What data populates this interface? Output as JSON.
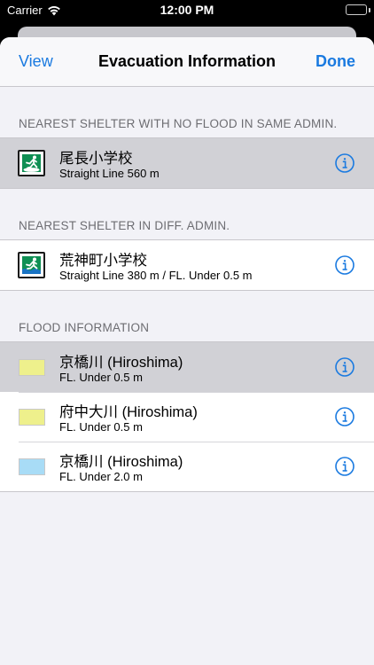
{
  "status_bar": {
    "carrier": "Carrier",
    "time": "12:00 PM"
  },
  "nav": {
    "left": "View",
    "title": "Evacuation Information",
    "right": "Done"
  },
  "sections": [
    {
      "header": "NEAREST SHELTER WITH NO FLOOD IN SAME ADMIN.",
      "rows": [
        {
          "title": "尾長小学校",
          "subtitle": "Straight Line 560 m",
          "icon": "evacuation-shelter-icon",
          "selected": true
        }
      ]
    },
    {
      "header": "NEAREST SHELTER IN DIFF. ADMIN.",
      "rows": [
        {
          "title": "荒神町小学校",
          "subtitle": "Straight Line 380 m / FL. Under 0.5 m",
          "icon": "evacuation-shelter-flood-icon",
          "selected": false
        }
      ]
    },
    {
      "header": "FLOOD INFORMATION",
      "rows": [
        {
          "title": "京橋川 (Hiroshima)",
          "subtitle": "FL. Under 0.5 m",
          "swatch_color": "#eef08c",
          "selected": true
        },
        {
          "title": "府中大川 (Hiroshima)",
          "subtitle": "FL. Under 0.5 m",
          "swatch_color": "#eef08c",
          "selected": false
        },
        {
          "title": "京橋川 (Hiroshima)",
          "subtitle": "FL. Under 2.0 m",
          "swatch_color": "#a8dcf6",
          "selected": false
        }
      ]
    }
  ],
  "colors": {
    "accent": "#1a7ae0",
    "shelter_green": "#0f8f54",
    "flood_blue": "#1a74c4"
  }
}
